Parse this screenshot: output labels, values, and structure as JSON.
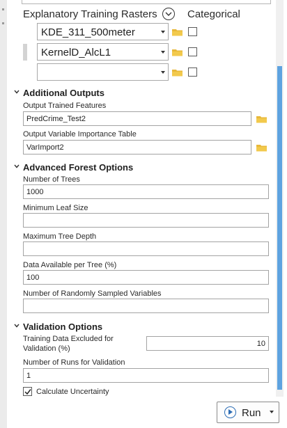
{
  "rasters": {
    "title": "Explanatory Training Rasters",
    "categorical_label": "Categorical",
    "rows": [
      {
        "value": "KDE_311_500meter",
        "categorical": false
      },
      {
        "value": "KernelD_AlcL1",
        "categorical": false
      },
      {
        "value": "",
        "categorical": false
      }
    ]
  },
  "additional_outputs": {
    "title": "Additional Outputs",
    "trained_features_label": "Output Trained Features",
    "trained_features_value": "PredCrime_Test2",
    "importance_label": "Output Variable Importance Table",
    "importance_value": "VarImport2"
  },
  "forest": {
    "title": "Advanced Forest Options",
    "num_trees_label": "Number of Trees",
    "num_trees_value": "1000",
    "min_leaf_label": "Minimum Leaf Size",
    "min_leaf_value": "",
    "max_depth_label": "Maximum Tree Depth",
    "max_depth_value": "",
    "data_per_tree_label": "Data Available per Tree (%)",
    "data_per_tree_value": "100",
    "sampled_vars_label": "Number of Randomly Sampled Variables",
    "sampled_vars_value": ""
  },
  "validation": {
    "title": "Validation Options",
    "excluded_label_line1": "Training Data Excluded for",
    "excluded_label_line2": "Validation (%)",
    "excluded_value": "10",
    "runs_label": "Number of Runs for Validation",
    "runs_value": "1",
    "uncertainty_label": "Calculate Uncertainty",
    "uncertainty_checked": true
  },
  "footer": {
    "run_label": "Run"
  },
  "colors": {
    "accent": "#5ea3e0",
    "folder": "#e8b83a"
  }
}
